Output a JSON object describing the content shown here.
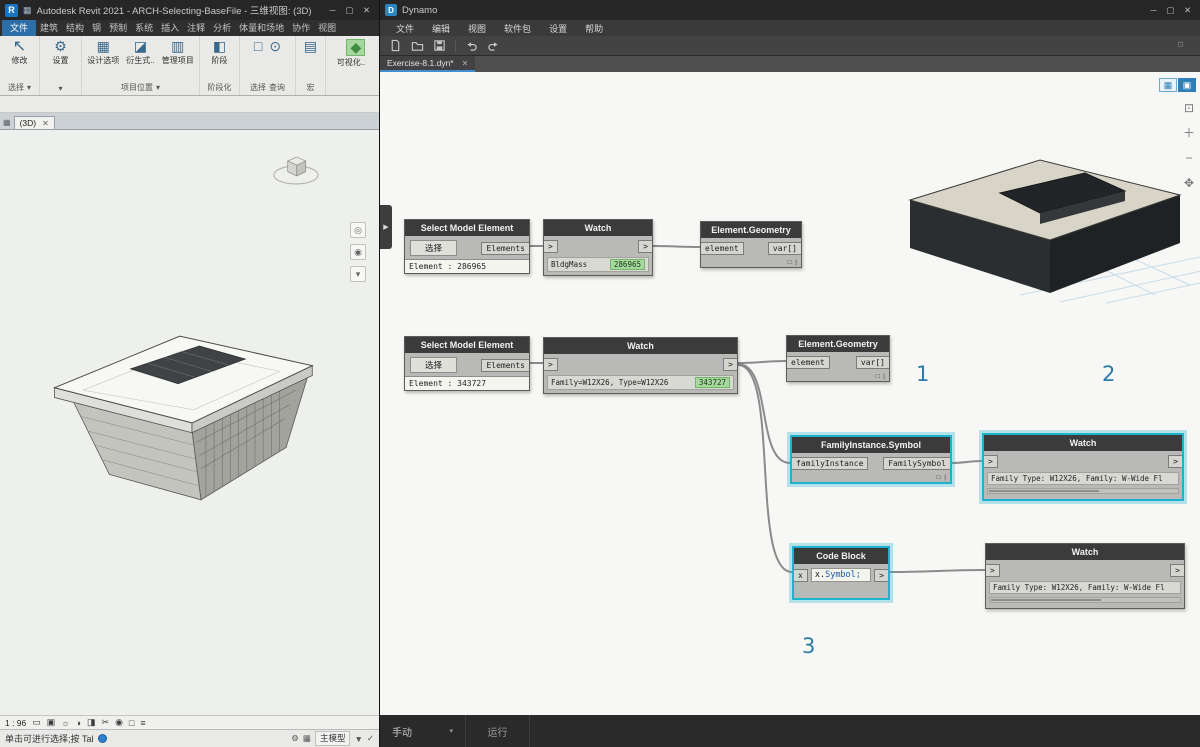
{
  "colors": {
    "selection_cyan": "#1db3cc",
    "value_green": "#a6d79f",
    "annotation_blue": "#2b7ca6",
    "revit_file_tab_blue": "#2d6da8",
    "dynamo_tab_accent": "#3f8fd0"
  },
  "icons": {
    "minimize": "─",
    "maximize": "▢",
    "close": "✕",
    "revit_logo": "R",
    "dynamo_logo": "D",
    "qat": "▦",
    "cursor": "↖",
    "gear": "⚙",
    "design_options": "▦",
    "generative": "◪",
    "manage_project": "▥",
    "phase": "◧",
    "pick": "□",
    "inquiry": "⊙",
    "macro": "▤",
    "visual": "◆",
    "caret_down": "▾",
    "view_close": "✕",
    "nav_wheel": "◎",
    "nav_zoom": "◉",
    "nav_caret": "▾",
    "zoom_fit": "⊡",
    "zoom_in": "＋",
    "zoom_out": "−",
    "zoom_pan": "✥",
    "library_expand": "▶",
    "toggle_graph": "▦",
    "toggle_geometry": "▣",
    "camera": "⌑"
  },
  "revit": {
    "title": "Autodesk Revit 2021 - ARCH-Selecting-BaseFile - 三维视图: (3D)",
    "file_tab": "文件",
    "tabs": [
      "建筑",
      "结构",
      "钢",
      "预制",
      "系统",
      "插入",
      "注释",
      "分析",
      "体量和场地",
      "协作",
      "视图"
    ],
    "ribbon": {
      "modify": "修改",
      "select_panel": "选择",
      "settings": "设置",
      "design_options": "设计选项",
      "generative": "衍生式..",
      "manage_project": "管理项目",
      "location_panel": "项目位置",
      "phase": "阶段",
      "phasing_panel": "阶段化",
      "select_label": "选择",
      "inquiry_label": "查询",
      "macro_label": "宏",
      "visual": "可视化.."
    },
    "view_tab": "(3D)",
    "scale": "1 : 96",
    "viewctl_icons": [
      "▭",
      "▣",
      "☼",
      "◑",
      "◨",
      "✂",
      "◉",
      "□",
      "≡"
    ],
    "status": {
      "message": "单击可进行选择;按 Tal",
      "pre_icons": [
        "⚙",
        "▦"
      ],
      "model": "主模型",
      "post_icons": [
        "▼",
        "✓"
      ]
    }
  },
  "dynamo": {
    "title": "Dynamo",
    "menus": [
      "文件",
      "编辑",
      "视图",
      "软件包",
      "设置",
      "帮助"
    ],
    "file_tab": "Exercise-8.1.dyn*",
    "run_mode": "手动",
    "run": "运行",
    "annotations": {
      "a1": "1",
      "a2": "2",
      "a3": "3"
    },
    "nodes": {
      "sme1": {
        "title": "Select Model Element",
        "button": "选择",
        "out": "Elements",
        "footer": "Element : 286965"
      },
      "watch1": {
        "title": "Watch",
        "in": ">",
        "out": ">",
        "label": "BldgMass",
        "value": "286965"
      },
      "eg1": {
        "title": "Element.Geometry",
        "in": "element",
        "out": "var[]",
        "lacing": "□ |"
      },
      "sme2": {
        "title": "Select Model Element",
        "button": "选择",
        "out": "Elements",
        "footer": "Element : 343727"
      },
      "watch2": {
        "title": "Watch",
        "in": ">",
        "out": ">",
        "label": "Family=W12X26, Type=W12X26",
        "value": "343727"
      },
      "eg2": {
        "title": "Element.Geometry",
        "in": "element",
        "out": "var[]",
        "lacing": "□ |"
      },
      "fis": {
        "title": "FamilyInstance.Symbol",
        "in": "familyInstance",
        "out": "FamilySymbol",
        "lacing": "□ |"
      },
      "watch3": {
        "title": "Watch",
        "in": ">",
        "out": ">",
        "value": "Family Type: W12X26, Family: W-Wide Fl"
      },
      "cb": {
        "title": "Code Block",
        "in": "x",
        "code_obj": "x.",
        "code_member": "Symbol;",
        "out": ">"
      },
      "watch4": {
        "title": "Watch",
        "in": ">",
        "out": ">",
        "value": "Family Type: W12X26, Family: W-Wide Fl"
      }
    }
  }
}
